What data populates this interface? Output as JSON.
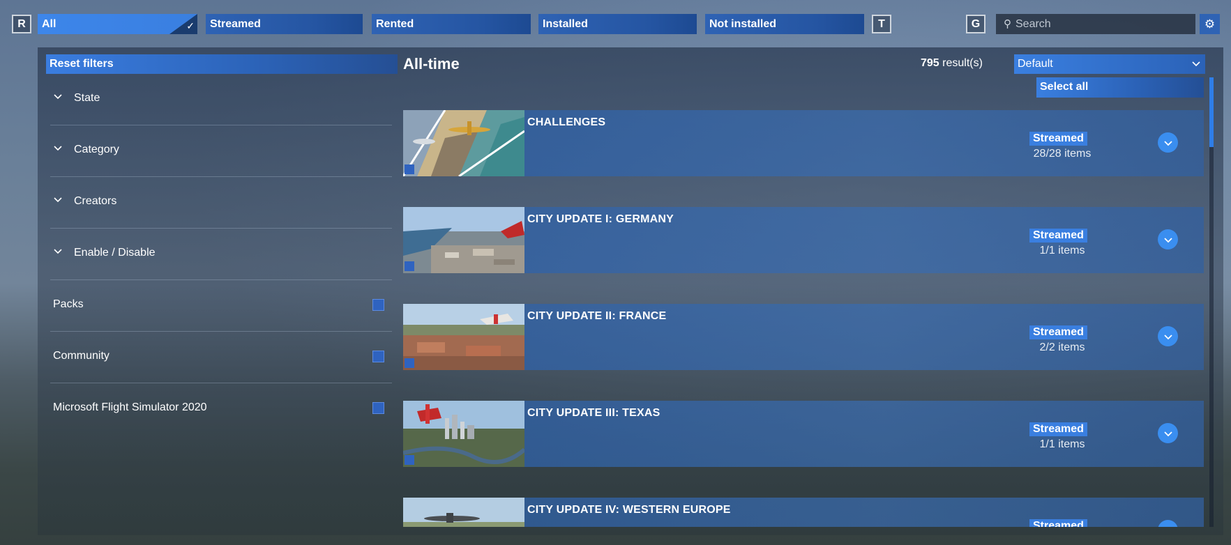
{
  "topbar": {
    "key_left": "R",
    "tabs": [
      {
        "label": "All",
        "active": true
      },
      {
        "label": "Streamed",
        "active": false
      },
      {
        "label": "Rented",
        "active": false
      },
      {
        "label": "Installed",
        "active": false
      },
      {
        "label": "Not installed",
        "active": false
      }
    ],
    "key_t": "T",
    "key_g": "G",
    "search_placeholder": "Search",
    "settings_icon": "gear-icon",
    "active_check": "✓"
  },
  "sidebar": {
    "reset_label": "Reset filters",
    "accordions": [
      {
        "label": "State"
      },
      {
        "label": "Category"
      },
      {
        "label": "Creators"
      },
      {
        "label": "Enable / Disable"
      }
    ],
    "toggles": [
      {
        "label": "Packs"
      },
      {
        "label": "Community"
      },
      {
        "label": "Microsoft Flight Simulator 2020"
      }
    ]
  },
  "content": {
    "title": "All-time",
    "result_count": "795",
    "result_suffix": " result(s)",
    "sort_value": "Default",
    "select_all_label": "Select all",
    "items": [
      {
        "name": "CHALLENGES",
        "status": "Streamed",
        "count": "28/28 items"
      },
      {
        "name": "CITY UPDATE I: GERMANY",
        "status": "Streamed",
        "count": "1/1 items"
      },
      {
        "name": "CITY UPDATE II: FRANCE",
        "status": "Streamed",
        "count": "2/2 items"
      },
      {
        "name": "CITY UPDATE III: TEXAS",
        "status": "Streamed",
        "count": "1/1 items"
      },
      {
        "name": "CITY UPDATE IV: WESTERN EUROPE",
        "status": "Streamed",
        "count": ""
      }
    ]
  },
  "colors": {
    "accent": "#3a7fe0",
    "tab_blue": "#2f63b4"
  }
}
